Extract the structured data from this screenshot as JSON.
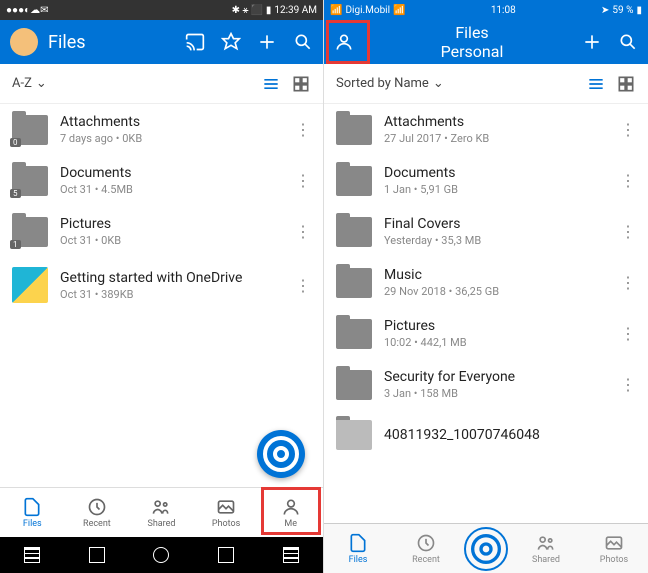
{
  "android": {
    "status": {
      "time": "12:39 AM"
    },
    "header": {
      "title": "Files"
    },
    "sort": {
      "label": "A-Z"
    },
    "items": [
      {
        "title": "Attachments",
        "sub": "7 days ago • 0KB",
        "badge": "0",
        "type": "folder"
      },
      {
        "title": "Documents",
        "sub": "Oct 31 • 4.5MB",
        "badge": "5",
        "type": "folder"
      },
      {
        "title": "Pictures",
        "sub": "Oct 31 • 0KB",
        "badge": "1",
        "type": "folder"
      },
      {
        "title": "Getting started with OneDrive",
        "sub": "Oct 31 • 389KB",
        "type": "thumb"
      }
    ],
    "nav": [
      {
        "label": "Files"
      },
      {
        "label": "Recent"
      },
      {
        "label": "Shared"
      },
      {
        "label": "Photos"
      },
      {
        "label": "Me"
      }
    ]
  },
  "ios": {
    "status": {
      "carrier": "Digi.Mobil",
      "time": "11:08",
      "battery": "59 %"
    },
    "header": {
      "title": "Files",
      "subtitle": "Personal"
    },
    "sort": {
      "label": "Sorted by Name"
    },
    "items": [
      {
        "title": "Attachments",
        "sub": "27 Jul 2017 • Zero KB"
      },
      {
        "title": "Documents",
        "sub": "1 Jan • 5,91 GB"
      },
      {
        "title": "Final Covers",
        "sub": "Yesterday • 35,3 MB"
      },
      {
        "title": "Music",
        "sub": "29 Nov 2018 • 36,25 GB"
      },
      {
        "title": "Pictures",
        "sub": "10:02 • 442,1 MB"
      },
      {
        "title": "Security for Everyone",
        "sub": "3 Jan • 158 MB"
      },
      {
        "title": "40811932_10070746048",
        "sub": ""
      }
    ],
    "nav": [
      {
        "label": "Files"
      },
      {
        "label": "Recent"
      },
      {
        "label": "Shared"
      },
      {
        "label": "Photos"
      }
    ]
  }
}
